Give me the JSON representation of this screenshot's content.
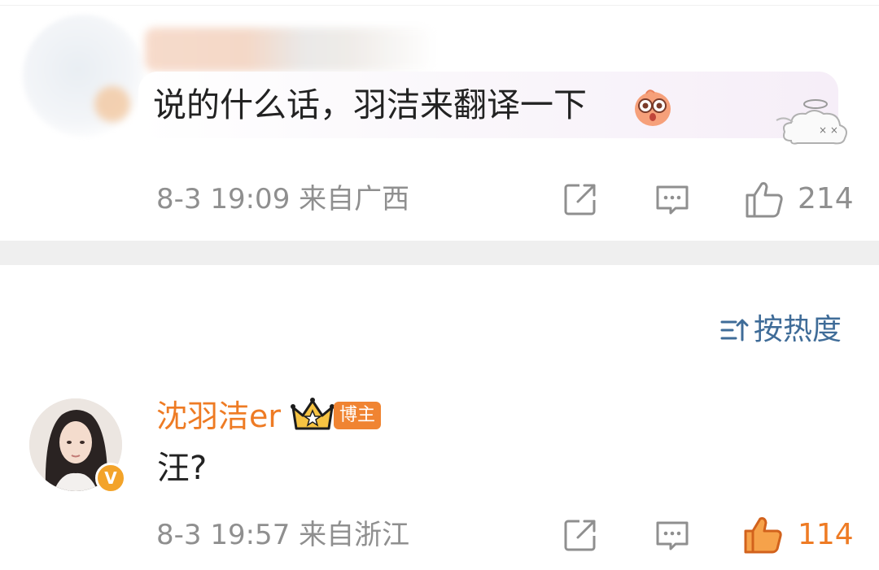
{
  "comment1": {
    "text": "说的什么话，羽洁来翻译一下",
    "timestamp": "8-3 19:09",
    "location": "来自广西",
    "like_count": "214",
    "emoji_icon": "surprised-face-sticker",
    "decoration_icon": "dizzy-cloud-sticker"
  },
  "sort": {
    "label": "按热度"
  },
  "comment2": {
    "author": "沈羽洁er",
    "badge": "博主",
    "text": "汪?",
    "timestamp": "8-3 19:57",
    "location": "来自浙江",
    "like_count": "114",
    "verified_mark": "V"
  },
  "colors": {
    "accent_orange": "#ee7b24",
    "link_blue": "#3f6c98",
    "meta_gray": "#8f8f8f",
    "divider": "#efefef"
  }
}
